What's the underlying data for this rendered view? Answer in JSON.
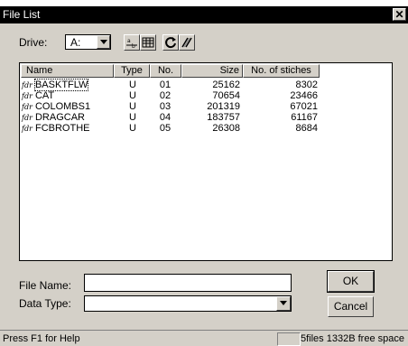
{
  "window": {
    "title": "File List",
    "close_glyph": "✕"
  },
  "drive": {
    "label": "Drive:",
    "value": "A:"
  },
  "toolbar": {
    "icons": [
      "sort-alpha-icon",
      "list-view-icon",
      "refresh-icon",
      "embroidery-icon"
    ]
  },
  "list": {
    "columns": [
      "Name",
      "Type",
      "No.",
      "Size",
      "No. of stiches"
    ],
    "file_prefix": "fdr",
    "rows": [
      {
        "name": "BASKTFLW",
        "type": "U",
        "no": "01",
        "size": "25162",
        "stitches": "8302"
      },
      {
        "name": "CAT",
        "type": "U",
        "no": "02",
        "size": "70654",
        "stitches": "23466"
      },
      {
        "name": "COLOMBS1",
        "type": "U",
        "no": "03",
        "size": "201319",
        "stitches": "67021"
      },
      {
        "name": "DRAGCAR",
        "type": "U",
        "no": "04",
        "size": "183757",
        "stitches": "61167"
      },
      {
        "name": "FCBROTHE",
        "type": "U",
        "no": "05",
        "size": "26308",
        "stitches": "8684"
      }
    ]
  },
  "form": {
    "file_name_label": "File Name:",
    "file_name_value": "",
    "data_type_label": "Data Type:",
    "data_type_value": ""
  },
  "buttons": {
    "ok": "OK",
    "cancel": "Cancel"
  },
  "status": {
    "help": "Press F1 for Help",
    "files": "5files",
    "space": "1332B free space"
  }
}
